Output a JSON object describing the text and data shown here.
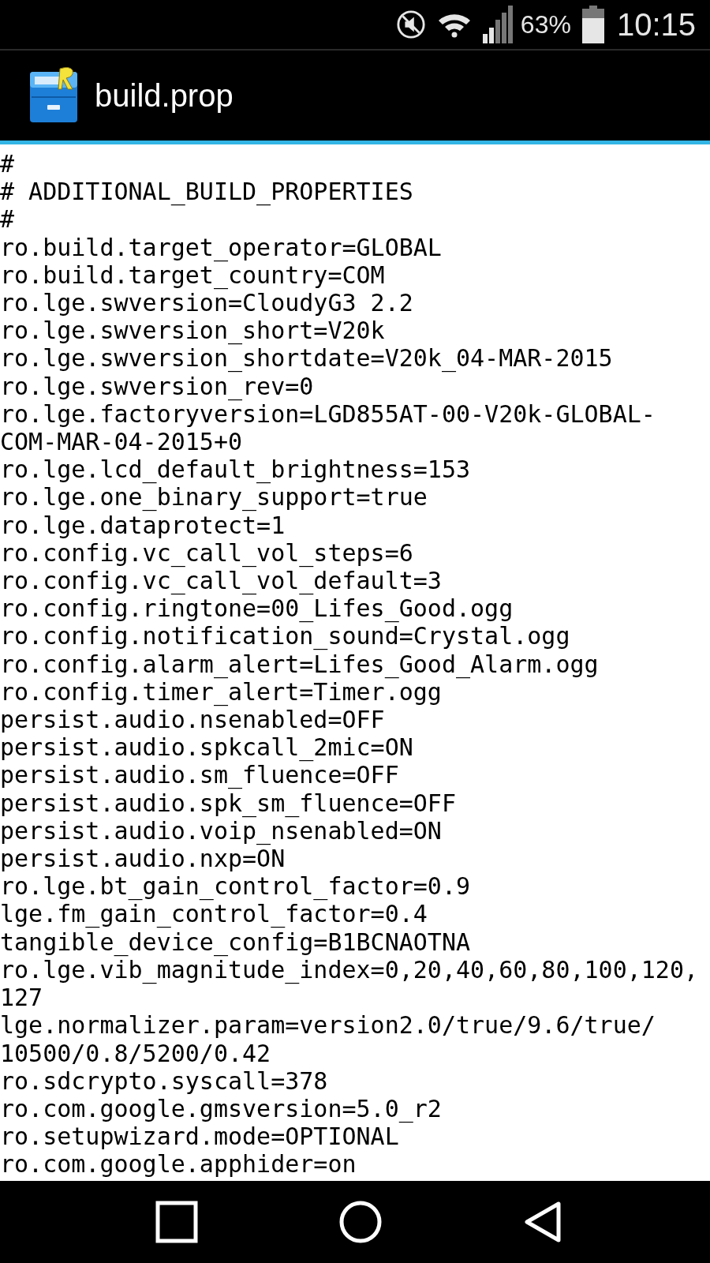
{
  "status_bar": {
    "battery": "63%",
    "time": "10:15"
  },
  "app_bar": {
    "title": "build.prop"
  },
  "editor": {
    "entries": [
      [
        "#"
      ],
      [
        "# ADDITIONAL_BUILD_PROPERTIES"
      ],
      [
        "#"
      ],
      [
        "ro.build.target_operator=GLOBAL"
      ],
      [
        "ro.build.target_country=COM"
      ],
      [
        "ro.lge.swversion=CloudyG3 2.2"
      ],
      [
        "ro.lge.swversion_short=V20k"
      ],
      [
        "ro.lge.swversion_shortdate=V20k_04-MAR-2015"
      ],
      [
        "ro.lge.swversion_rev=0"
      ],
      [
        "ro.lge.factoryversion=LGD855AT-00-V20k-GLOBAL-",
        "COM-MAR-04-2015+0"
      ],
      [
        "ro.lge.lcd_default_brightness=153"
      ],
      [
        "ro.lge.one_binary_support=true"
      ],
      [
        "ro.lge.dataprotect=1"
      ],
      [
        "ro.config.vc_call_vol_steps=6"
      ],
      [
        "ro.config.vc_call_vol_default=3"
      ],
      [
        "ro.config.ringtone=00_Lifes_Good.ogg"
      ],
      [
        "ro.config.notification_sound=Crystal.ogg"
      ],
      [
        "ro.config.alarm_alert=Lifes_Good_Alarm.ogg"
      ],
      [
        "ro.config.timer_alert=Timer.ogg"
      ],
      [
        "persist.audio.nsenabled=OFF"
      ],
      [
        "persist.audio.spkcall_2mic=ON"
      ],
      [
        "persist.audio.sm_fluence=OFF"
      ],
      [
        "persist.audio.spk_sm_fluence=OFF"
      ],
      [
        "persist.audio.voip_nsenabled=ON"
      ],
      [
        "persist.audio.nxp=ON"
      ],
      [
        "ro.lge.bt_gain_control_factor=0.9"
      ],
      [
        "lge.fm_gain_control_factor=0.4"
      ],
      [
        "tangible_device_config=B1BCNAOTNA"
      ],
      [
        "ro.lge.vib_magnitude_index=0,20,40,60,80,100,120,",
        "127"
      ],
      [
        "lge.normalizer.param=version2.0/true/9.6/true/",
        "10500/0.8/5200/0.42"
      ],
      [
        "ro.sdcrypto.syscall=378"
      ],
      [
        "ro.com.google.gmsversion=5.0_r2"
      ],
      [
        "ro.setupwizard.mode=OPTIONAL"
      ],
      [
        "ro.com.google.apphider=on"
      ]
    ]
  }
}
